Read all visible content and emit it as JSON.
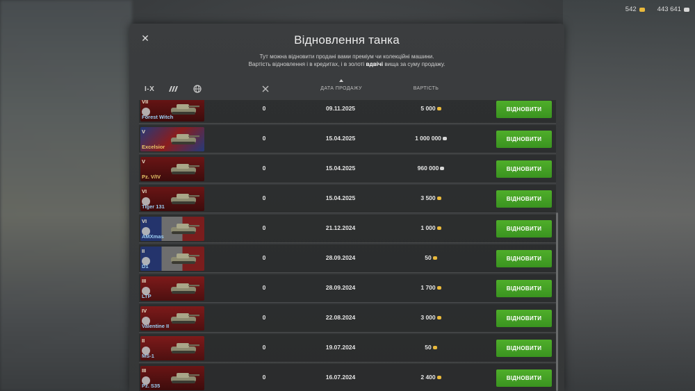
{
  "currency": {
    "gold": "542",
    "silver": "443 641"
  },
  "dialog": {
    "title": "Відновлення танка",
    "desc_line1": "Тут можна відновити продані вами преміум чи колекційні машини.",
    "desc_line2_before": "Вартість відновлення і в кредитах, і в золоті ",
    "desc_line2_bold": "вдвічі",
    "desc_line2_after": " вища за суму продажу."
  },
  "filters": {
    "tier_label": "I-X",
    "type_icon": "vehicle-type-icon",
    "nation_icon": "globe-icon"
  },
  "columns": {
    "battles_icon": "crossed-swords-icon",
    "date": "ДАТА ПРОДАЖУ",
    "price": "ВАРТІСТЬ"
  },
  "restore_label": "ВІДНОВИТИ",
  "rows": [
    {
      "tier": "VII",
      "name": "Forest Witch",
      "battles": "0",
      "date": "09.11.2025",
      "price": "5 000",
      "currency": "gold",
      "nation": "de",
      "premium": false
    },
    {
      "tier": "V",
      "name": "Excelsior",
      "battles": "0",
      "date": "15.04.2025",
      "price": "1 000 000",
      "currency": "silver",
      "nation": "uk",
      "premium": true
    },
    {
      "tier": "V",
      "name": "Pz. V/IV",
      "battles": "0",
      "date": "15.04.2025",
      "price": "960 000",
      "currency": "silver",
      "nation": "de",
      "premium": true
    },
    {
      "tier": "VI",
      "name": "Tiger 131",
      "battles": "0",
      "date": "15.04.2025",
      "price": "3 500",
      "currency": "gold",
      "nation": "de",
      "premium": false
    },
    {
      "tier": "VI",
      "name": "AMXmas",
      "battles": "0",
      "date": "21.12.2024",
      "price": "1 000",
      "currency": "gold",
      "nation": "fr",
      "premium": false
    },
    {
      "tier": "II",
      "name": "D1",
      "battles": "0",
      "date": "28.09.2024",
      "price": "50",
      "currency": "gold",
      "nation": "fr",
      "premium": false
    },
    {
      "tier": "III",
      "name": "LTP",
      "battles": "0",
      "date": "28.09.2024",
      "price": "1 700",
      "currency": "gold",
      "nation": "ussr",
      "premium": false
    },
    {
      "tier": "IV",
      "name": "Valentine II",
      "battles": "0",
      "date": "22.08.2024",
      "price": "3 000",
      "currency": "gold",
      "nation": "ussr",
      "premium": false
    },
    {
      "tier": "II",
      "name": "MS-1",
      "battles": "0",
      "date": "19.07.2024",
      "price": "50",
      "currency": "gold",
      "nation": "ussr",
      "premium": false
    },
    {
      "tier": "III",
      "name": "Pz. S35",
      "battles": "0",
      "date": "16.07.2024",
      "price": "2 400",
      "currency": "gold",
      "nation": "de",
      "premium": false
    }
  ]
}
